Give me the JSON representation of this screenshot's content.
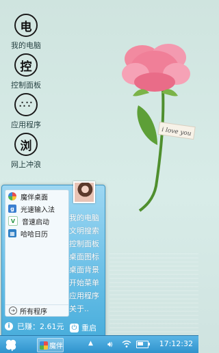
{
  "desktop": {
    "icons": [
      {
        "glyph": "电",
        "label": "我的电脑",
        "icon": "computer-ink-icon"
      },
      {
        "glyph": "控",
        "label": "控制面板",
        "icon": "control-panel-ink-icon"
      },
      {
        "glyph": "∴∵",
        "label": "应用程序",
        "icon": "apps-ink-icon"
      },
      {
        "glyph": "浏",
        "label": "网上冲浪",
        "icon": "browser-ink-icon"
      }
    ],
    "wallpaper_tag": "i love you"
  },
  "start_menu": {
    "items": [
      {
        "label": "魔伴桌面",
        "icon": "mobanzhuomian-icon",
        "color": "#e8583a"
      },
      {
        "label": "光速输入法",
        "icon": "guangsu-input-icon",
        "color": "#3a7fd0"
      },
      {
        "label": "音速启动",
        "icon": "yinsu-launch-icon",
        "color": "#3aa05a"
      },
      {
        "label": "哈哈日历",
        "icon": "calendar-icon",
        "color": "#2f7fc4"
      }
    ],
    "all_programs": "所有程序",
    "right_links": [
      "我的电脑",
      "文明搜索",
      "控制面板",
      "桌面图标",
      "桌面背景",
      "开始菜单",
      "应用程序",
      "关于.."
    ],
    "earnings_label": "已赚：2.61元",
    "power_label": "重启"
  },
  "taskbar": {
    "task_label": "魔伴",
    "clock": "17:12:32",
    "battery_level": 0.6
  },
  "colors": {
    "accent": "#3a9ed0",
    "taskbar": "#2f93cc"
  }
}
